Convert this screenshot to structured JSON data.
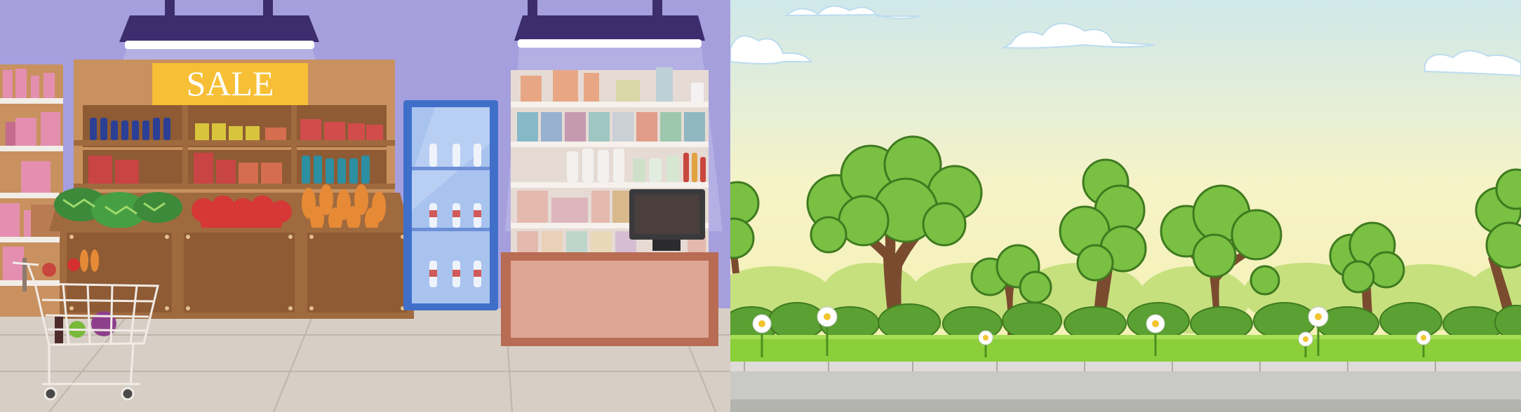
{
  "store_scene": {
    "sale_sign": "SALE",
    "colors": {
      "wall": "#a59fde",
      "floor": "#d7cfc6",
      "shelf_wood": "#c8915f",
      "counter": "#dea595",
      "fridge": "#3f6fc9",
      "lamp": "#3e2d6e",
      "sign": "#f6bf35"
    },
    "icons": [
      "ceiling-lamp-icon",
      "shopping-cart-icon",
      "cash-register-icon",
      "watermelon-icon",
      "tomato-icon",
      "bread-icon",
      "bottle-icon"
    ]
  },
  "park_scene": {
    "colors": {
      "sky_top": "#cfe8ea",
      "sky_bottom": "#f6f3c7",
      "tree_leaves": "#79c043",
      "trunk": "#7b4b2f",
      "grass": "#8bcf3a",
      "sidewalk": "#c9c9c6"
    },
    "icons": [
      "cloud-icon",
      "tree-icon",
      "bush-icon",
      "daisy-icon"
    ]
  }
}
